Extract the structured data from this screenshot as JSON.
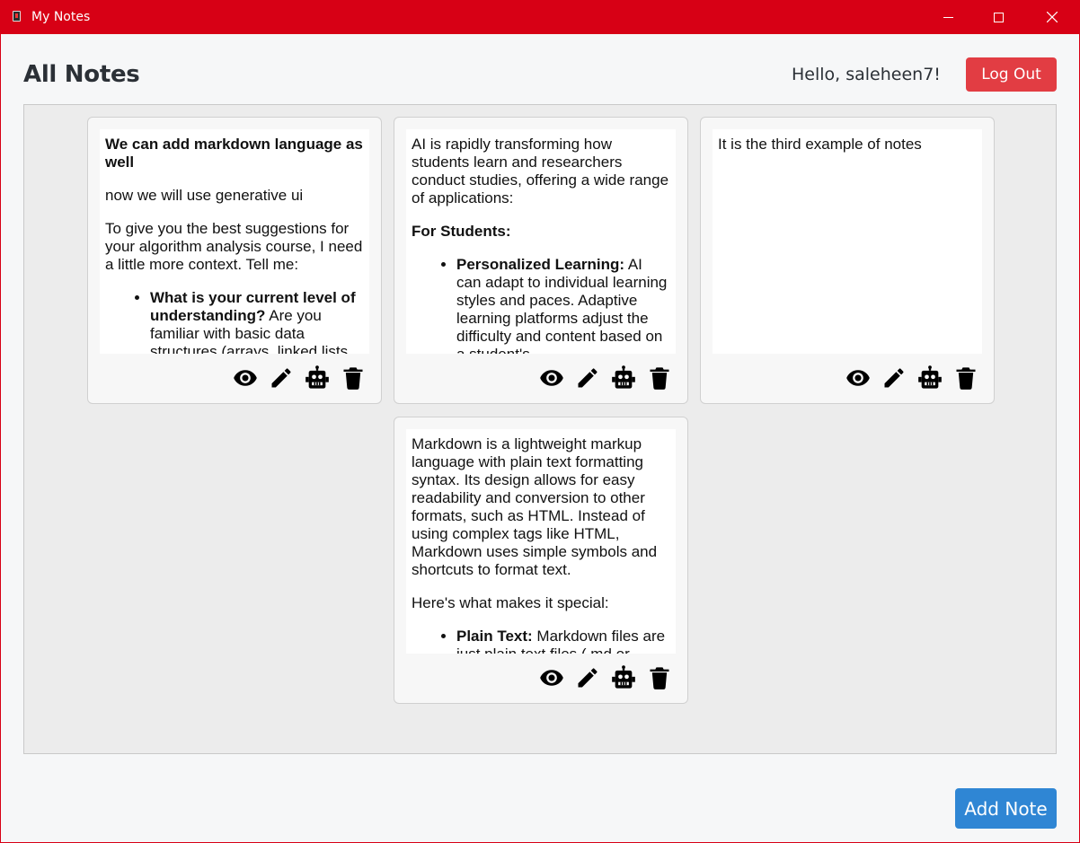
{
  "window": {
    "title": "My Notes",
    "accent_color": "#d70015"
  },
  "header": {
    "title": "All Notes",
    "greeting": "Hello, saleheen7!",
    "logout_label": "Log Out"
  },
  "notes": [
    {
      "heading": "We can add markdown language as well",
      "p1": "now we will use generative ui",
      "p2": "To give you the best suggestions for your algorithm analysis course, I need a little more context. Tell me:",
      "li_bold": "What is your current level of understanding?",
      "li_text": " Are you familiar with basic data structures (arrays, linked lists"
    },
    {
      "p1": "AI is rapidly transforming how students learn and researchers conduct studies, offering a wide range of applications:",
      "heading": "For Students:",
      "li_bold": "Personalized Learning:",
      "li_text": " AI can adapt to individual learning styles and paces. Adaptive learning platforms adjust the difficulty and content based on a student's"
    },
    {
      "p1": "It is the third example of notes"
    },
    {
      "p1": "Markdown is a lightweight markup language with plain text formatting syntax. Its design allows for easy readability and conversion to other formats, such as HTML. Instead of using complex tags like HTML, Markdown uses simple symbols and shortcuts to format text.",
      "p2": "Here's what makes it special:",
      "li_bold": "Plain Text:",
      "li_text": " Markdown files are just plain text files (.md or"
    }
  ],
  "note_actions": [
    "view-icon",
    "edit-icon",
    "robot-icon",
    "trash-icon"
  ],
  "footer": {
    "add_label": "Add Note",
    "add_color": "#2f86d4",
    "logout_color": "#e23d43"
  }
}
